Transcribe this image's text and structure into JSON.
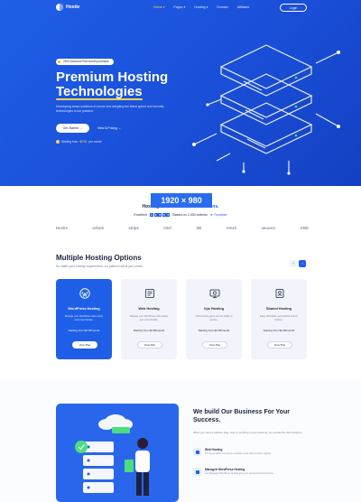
{
  "nav": {
    "logo": "Hostie",
    "items": [
      {
        "label": "Home ▾",
        "active": true
      },
      {
        "label": "Pages ▾",
        "active": false
      },
      {
        "label": "Hosting ▾",
        "active": false
      },
      {
        "label": "Domain",
        "active": false
      },
      {
        "label": "Affiliates",
        "active": false
      }
    ],
    "login": "Login"
  },
  "hero": {
    "badge": "25% Discount First month purchase",
    "title_line1": "Premium Hosting",
    "title_line2": "Technologies",
    "subtitle": "Developing smart solutions in-house and adopting the latest speed and security technologies is our passion.",
    "primary_button": "Get Started →",
    "secondary_button": "View & Pricing →",
    "starting_text": "Starting from",
    "starting_price": "$2.95",
    "starting_suffix": "per month"
  },
  "overlay": {
    "label": "1920 × 980"
  },
  "trust": {
    "title_start": "Hosting solutions",
    "title_highlight": "500,000 domains.",
    "rating_label": "Excellent",
    "rating_text": "Based on 1,000 reviews",
    "trustpilot": "★ Trustpilot",
    "logos": [
      "Hostie",
      "airbnb",
      "stripe",
      "intel",
      "3M",
      "ASUS",
      "amazon",
      "AMD"
    ]
  },
  "options": {
    "title": "Multiple Hosting Options",
    "subtitle": "No matter your hosting requirements, our platform will fit your needs.",
    "prev": "‹",
    "next": "›",
    "cards": [
      {
        "name": "WordPress Hosting",
        "desc": "Manage your WordPress sites easily and more flexible.",
        "price": "Starting from $2.95/month",
        "button": "View Plan",
        "icon": "wordpress-icon",
        "active": true
      },
      {
        "name": "Web Hosting",
        "desc": "Manage your WordPress sites easily and more flexible.",
        "price": "Starting from $2.95/month",
        "button": "View Plan",
        "icon": "web-hosting-icon",
        "active": false
      },
      {
        "name": "Vps Hosting",
        "desc": "VPS Hosting gives you the ability to access.",
        "price": "Starting from $2.95/month",
        "button": "View Plan",
        "icon": "vps-icon",
        "active": false
      },
      {
        "name": "Shared Hosting",
        "desc": "Easy, affordable, and reliable shared hosting.",
        "price": "Starting from $2.95/month",
        "button": "View Plan",
        "icon": "shared-hosting-icon",
        "active": false
      }
    ]
  },
  "build": {
    "title": "We build Our Business For Your Success.",
    "subtitle": "When you need a website, blog, store or anything in your business, we provide the right solutions.",
    "features": [
      {
        "title": "Web Hosting",
        "desc": "The best platform for all your website needs with premium support."
      },
      {
        "title": "Managed WordPress Hosting",
        "desc": "Our Managed WordPress hosting gives you speed and performance."
      }
    ]
  },
  "colors": {
    "primary": "#1f5fe8",
    "accent": "#ffd44d",
    "dark": "#1b2340"
  }
}
